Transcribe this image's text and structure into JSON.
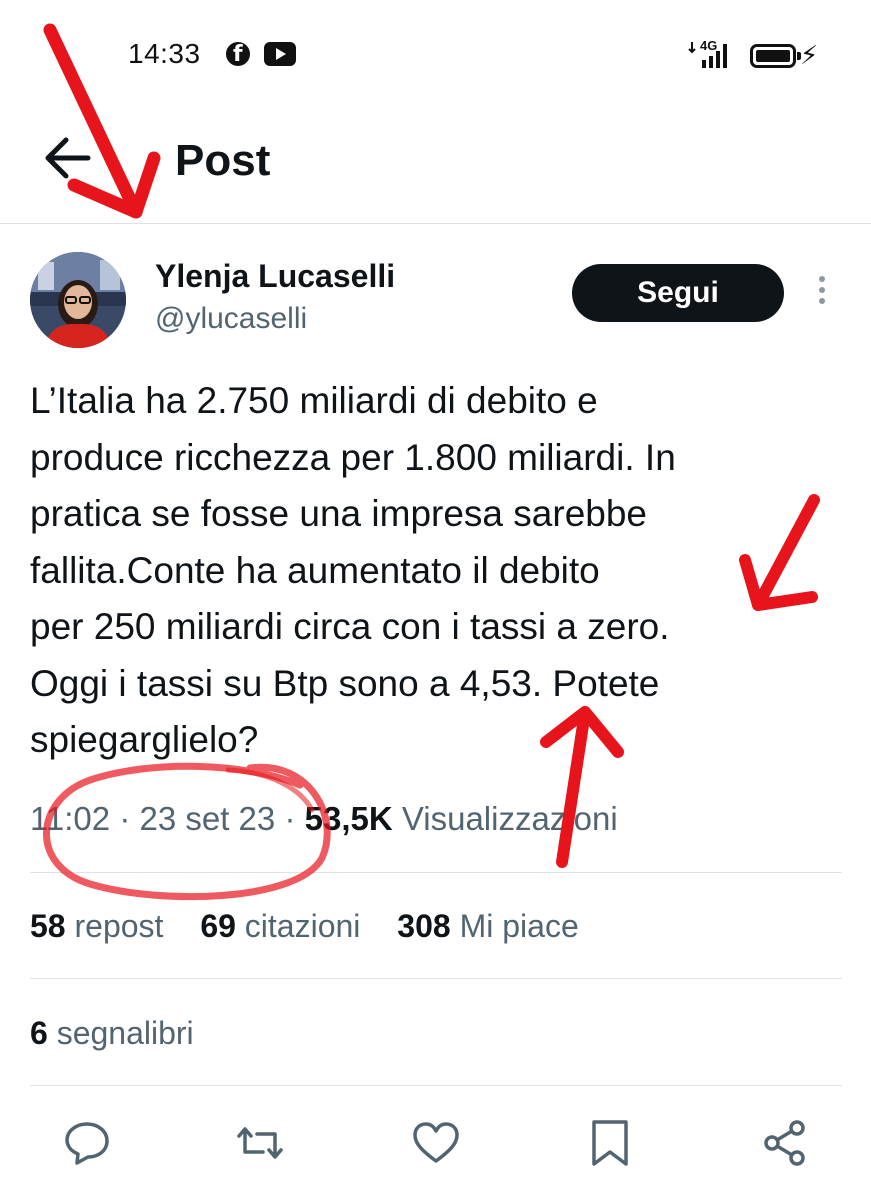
{
  "status_bar": {
    "time": "14:33",
    "network": "4G",
    "icons": [
      "facebook-icon",
      "youtube-icon",
      "signal-icon",
      "battery-icon",
      "charging-icon"
    ]
  },
  "header": {
    "title": "Post",
    "back_icon": "arrow-left-icon"
  },
  "author": {
    "name": "Ylenja Lucaselli",
    "handle": "@ylucaselli",
    "follow_label": "Segui"
  },
  "post": {
    "lines": [
      "L’Italia ha 2.750 miliardi di debito e",
      "produce ricchezza per 1.800 miliardi. In",
      "pratica se fosse una impresa sarebbe",
      "fallita.Conte ha aumentato il debito",
      "per 250 miliardi circa con i tassi a zero.",
      "Oggi i tassi su Btp sono a 4,53. Potete",
      "spiegarglielo?"
    ]
  },
  "meta": {
    "time": "11:02",
    "separator": "·",
    "date": "23 set 23",
    "views_count": "53,5K",
    "views_label": "Visualizzazioni"
  },
  "stats": {
    "reposts_count": "58",
    "reposts_label": "repost",
    "quotes_count": "69",
    "quotes_label": "citazioni",
    "likes_count": "308",
    "likes_label": "Mi piace",
    "bookmarks_count": "6",
    "bookmarks_label": "segnalibri"
  },
  "actions": [
    "reply-icon",
    "repost-icon",
    "like-icon",
    "bookmark-icon",
    "share-icon"
  ],
  "colors": {
    "text": "#0f1419",
    "secondary": "#536471",
    "divider": "#dfe3e6",
    "follow_bg": "#0f1419",
    "annotation": "#e8141c"
  }
}
